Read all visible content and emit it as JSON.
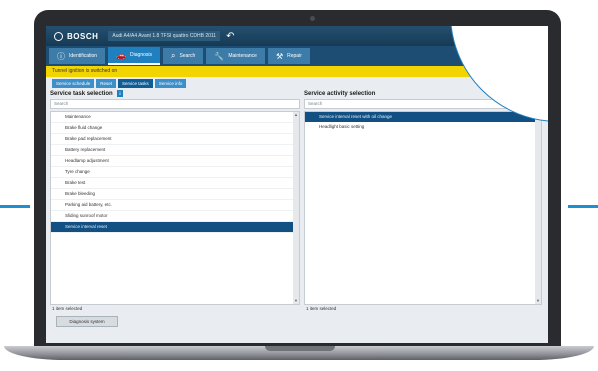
{
  "app": {
    "brand": "BOSCH",
    "vehicle_info": "Audi A4/A4 Avant 1.8 TFSI quattro CDHB 2011",
    "warning": "Tunnel ignition is switched on",
    "left_panel_title": "Service task selection",
    "right_panel_title": "Service activity selection",
    "search_placeholder": "Search",
    "diagnosis_button": "Diagnosis system",
    "footer_left": "1 item selected",
    "footer_right": "1 item selected",
    "badge": "i"
  },
  "nav": {
    "tabs": [
      {
        "label": "Identification",
        "icon": "info-icon"
      },
      {
        "label": "Diagnosis",
        "icon": "car-icon",
        "active": true
      },
      {
        "label": "Search",
        "icon": "search-icon"
      },
      {
        "label": "Maintenance",
        "icon": "wrench-icon"
      },
      {
        "label": "Repair",
        "icon": "tools-icon"
      }
    ]
  },
  "subtabs": [
    {
      "label": "Service schedule"
    },
    {
      "label": "Reset"
    },
    {
      "label": "Service tasks",
      "active": true
    },
    {
      "label": "Service info"
    }
  ],
  "tasks": [
    {
      "label": "Maintenance"
    },
    {
      "label": "Brake fluid change"
    },
    {
      "label": "Brake pad replacement"
    },
    {
      "label": "Battery replacement"
    },
    {
      "label": "Headlamp adjustment"
    },
    {
      "label": "Tyre change"
    },
    {
      "label": "Brake test"
    },
    {
      "label": "Brake bleeding"
    },
    {
      "label": "Parking aid battery, etc."
    },
    {
      "label": "Sliding sunroof motor"
    },
    {
      "label": "Service interval reset",
      "selected": true
    }
  ],
  "activities": [
    {
      "label": "Service interval reset with oil change",
      "selected": true
    },
    {
      "label": "Headlight basic setting"
    }
  ],
  "colors": {
    "accent": "#1f7fbf",
    "warning": "#f2d500",
    "selected": "#124f82"
  }
}
